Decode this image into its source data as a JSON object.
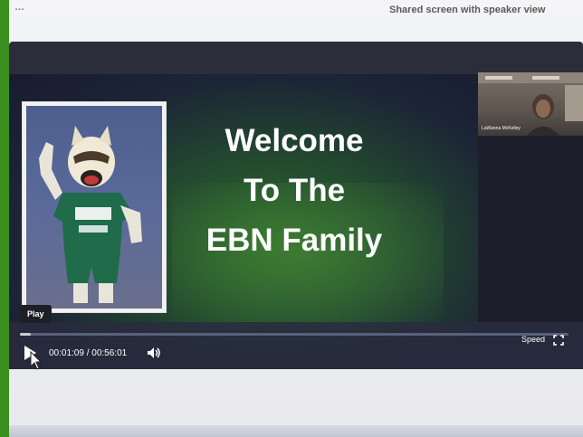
{
  "window": {
    "top_title_fragment": "Shared screen with speaker view",
    "top_left_fragment": "…"
  },
  "slide": {
    "heading_lines": [
      "Welcome",
      "To The",
      "EBN Family"
    ]
  },
  "speaker_tile": {
    "name": "LaWanna McKelley"
  },
  "player": {
    "play_tooltip": "Play",
    "current_time": "00:01:09",
    "time_separator": "/",
    "duration": "00:56:01",
    "progress_fraction": 0.02,
    "speed_label": "Speed"
  },
  "icons": {
    "play": "play-icon",
    "volume": "volume-icon",
    "fullscreen": "fullscreen-icon"
  },
  "colors": {
    "frame_green": "#3a8f1e",
    "player_bg": "#2b2e3a",
    "slide_green": "#2f6b2a"
  }
}
